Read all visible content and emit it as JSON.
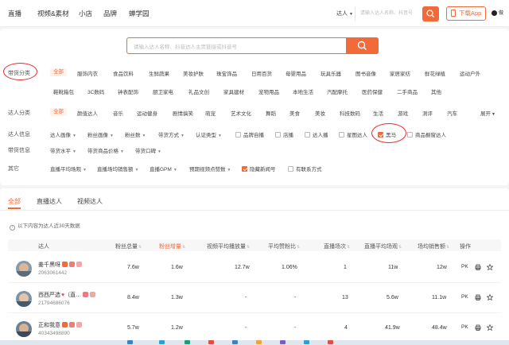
{
  "nav": {
    "items": [
      "直播",
      "视频&素材",
      "小店",
      "品牌",
      "蝉学园"
    ],
    "search_type": "达人",
    "search_placeholder": "请输入达人名称、抖音号",
    "app_button": "下载App",
    "user_label": "做"
  },
  "filters": {
    "search_placeholder": "请输入达人名称、抖音达人主页链接或抖音号",
    "category_label": "带货分类",
    "categories_row1": [
      "全部",
      "服饰内衣",
      "食品饮料",
      "生鲜蔬果",
      "美妆护肤",
      "珠宝饰品",
      "日用百货",
      "母婴用品",
      "玩具乐器",
      "图书音像",
      "家居家纺",
      "鲜花绿植",
      "运动户外"
    ],
    "categories_row2": [
      "鞋靴箱包",
      "3C数码",
      "钟表配饰",
      "厨卫家电",
      "礼品文创",
      "家具建材",
      "宠物用品",
      "本地生活",
      "汽配摩托",
      "医药保健",
      "二手商品",
      "其他"
    ],
    "talent_category_label": "达人分类",
    "talent_categories": [
      "全部",
      "颜值达人",
      "音乐",
      "运动健身",
      "剧情搞笑",
      "萌宠",
      "艺术文化",
      "舞蹈",
      "美食",
      "美妆",
      "科技数码",
      "生活",
      "游戏",
      "测评",
      "汽车"
    ],
    "expand_label": "展开",
    "info_label": "达人信息",
    "info_dropdowns": [
      "达人画像",
      "粉丝画像",
      "粉丝数",
      "带货方式",
      "认证类型"
    ],
    "info_checkboxes": [
      {
        "label": "品牌自播",
        "checked": false
      },
      {
        "label": "店播",
        "checked": false
      },
      {
        "label": "达人播",
        "checked": false
      },
      {
        "label": "星图达人",
        "checked": false
      },
      {
        "label": "黑马",
        "checked": true
      },
      {
        "label": "商品橱窗达人",
        "checked": false
      }
    ],
    "goods_label": "带货信息",
    "goods_dropdowns": [
      "带货水平",
      "带货商品价格",
      "带货口碑"
    ],
    "other_label": "其它",
    "other_dropdowns": [
      "直播平均场观",
      "直播场均销售额",
      "直播GPM",
      "预期视频点赞数"
    ],
    "other_checkboxes": [
      {
        "label": "隐藏新闻号",
        "checked": true
      },
      {
        "label": "有联系方式",
        "checked": false
      }
    ]
  },
  "results": {
    "tabs": [
      "全部",
      "直播达人",
      "视频达人"
    ],
    "note": "以下内容为达人近30天数据",
    "columns": [
      "达人",
      "粉丝总量",
      "粉丝增量",
      "视频平均播放量",
      "平均赞粉比",
      "直播场次",
      "直播平均场观",
      "场均销售额",
      "操作"
    ],
    "rows": [
      {
        "name": "姜千黑呀",
        "uid": "2063061442",
        "fans": "7.6w",
        "growth": "1.6w",
        "avg_play": "12.7w",
        "like_ratio": "1.06%",
        "live_count": "1",
        "avg_view": "11w",
        "avg_sales": "12w"
      },
      {
        "name": "西西严选",
        "name_suffix": "（直…",
        "uid": "21794686076",
        "fans": "8.4w",
        "growth": "1.3w",
        "avg_play": "-",
        "like_ratio": "-",
        "live_count": "13",
        "avg_view": "5.6w",
        "avg_sales": "11.1w"
      },
      {
        "name": "正和我意",
        "uid": "40343498890",
        "fans": "5.7w",
        "growth": "1.2w",
        "avg_play": "-",
        "like_ratio": "-",
        "live_count": "4",
        "avg_view": "41.9w",
        "avg_sales": "48.4w"
      }
    ],
    "op_pk": "PK"
  },
  "colors": {
    "accent": "#f2693a",
    "annotation": "#e8262b"
  },
  "icons": [
    "search-icon",
    "phone-icon",
    "info-icon",
    "print-icon",
    "star-icon"
  ]
}
